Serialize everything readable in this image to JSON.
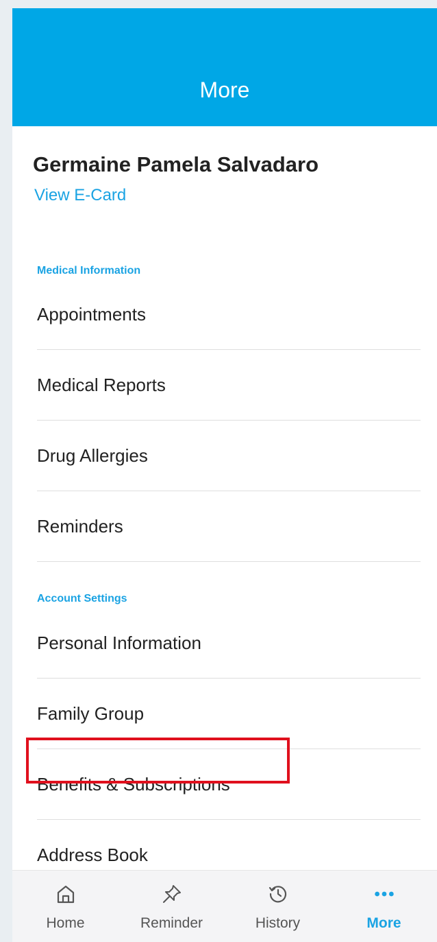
{
  "header": {
    "title": "More"
  },
  "profile": {
    "name": "Germaine Pamela Salvadaro",
    "ecard_link": "View E-Card"
  },
  "sections": {
    "medical": {
      "label": "Medical Information",
      "items": [
        "Appointments",
        "Medical Reports",
        "Drug Allergies",
        "Reminders"
      ]
    },
    "account": {
      "label": "Account Settings",
      "items": [
        "Personal Information",
        "Family Group",
        "Benefits & Subscriptions",
        "Address Book"
      ]
    }
  },
  "tabbar": {
    "tabs": [
      {
        "label": "Home",
        "icon": "home-icon"
      },
      {
        "label": "Reminder",
        "icon": "pin-icon"
      },
      {
        "label": "History",
        "icon": "history-icon"
      },
      {
        "label": "More",
        "icon": "more-dots-icon"
      }
    ],
    "active": "More"
  },
  "colors": {
    "primary": "#00a7e6",
    "link": "#1aa3e3",
    "highlight": "#e0101d",
    "text": "#222222"
  }
}
